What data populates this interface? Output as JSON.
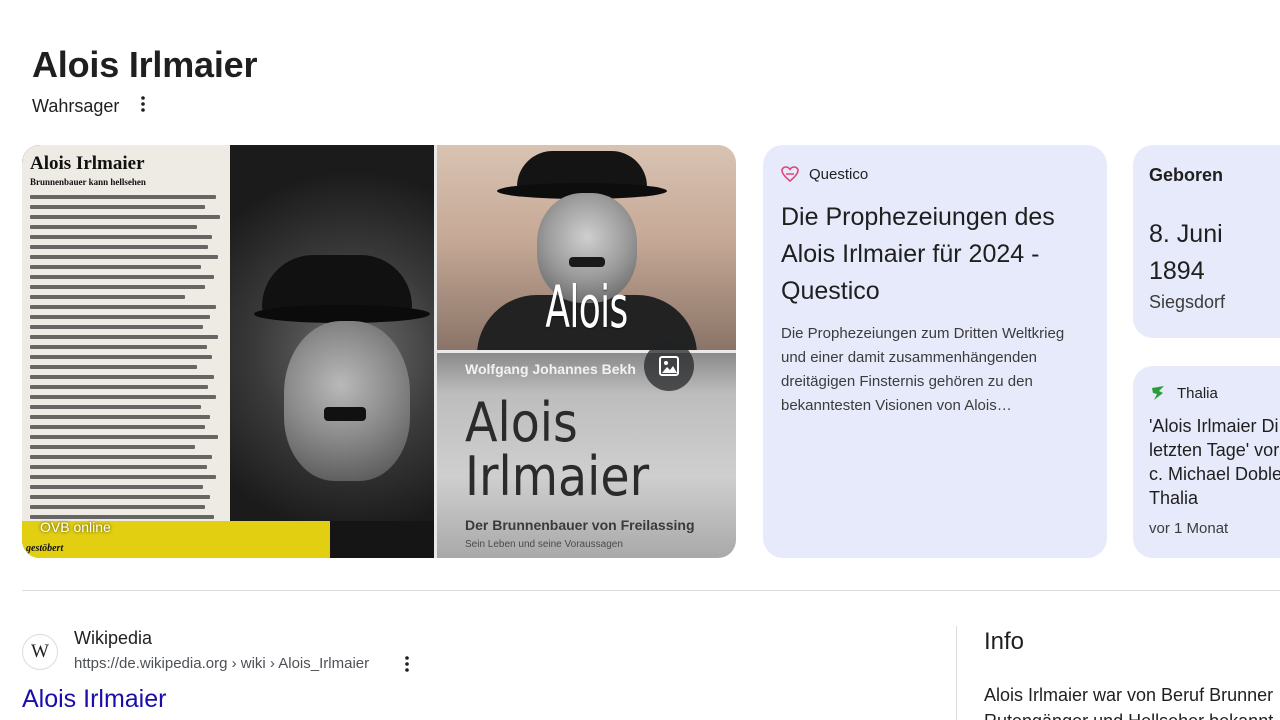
{
  "panel": {
    "title": "Alois Irlmaier",
    "subtitle": "Wahrsager"
  },
  "images": {
    "newspaper_title": "Alois Irlmaier",
    "newspaper_subtitle": "Brunnenbauer kann hellsehen",
    "newspaper_label": "gestöbert",
    "left_source": "OVB online",
    "cover_top_text": "Alois Irlmaier",
    "cover_author": "Wolfgang Johannes Bekh",
    "cover_title_line1": "Alois",
    "cover_title_line2": "Irlmaier",
    "cover_subtitle": "Der Brunnenbauer von Freilassing",
    "cover_subtitle2": "Sein Leben und seine Voraussagen"
  },
  "cards": {
    "questico": {
      "source": "Questico",
      "title": "Die Prophezeiungen des Alois Irlmaier für 2024 - Questico",
      "description": "Die Prophezeiungen zum Dritten Weltkrieg und einer damit zusammenhängenden dreitägigen Finsternis gehören zu den bekanntesten Visionen von Alois…",
      "accent": "#e0457b"
    },
    "geboren": {
      "label": "Geboren",
      "date": "8. Juni 1894",
      "place": "Siegsdorf"
    },
    "thalia": {
      "source": "Thalia",
      "title": "'Alois Irlmaier Di\nletzten Tage' vor\nc. Michael Doble\nThalia",
      "time": "vor 1 Monat",
      "accent": "#2a9d3a"
    }
  },
  "result": {
    "favicon": "W",
    "site": "Wikipedia",
    "url": "https://de.wikipedia.org › wiki › Alois_Irlmaier",
    "title": "Alois Irlmaier",
    "link_color": "#1a0dab"
  },
  "info": {
    "heading": "Info",
    "text_line1": "Alois Irlmaier war von Beruf Brunner",
    "text_line2": "Rutengänger und Hellseher bekannt"
  }
}
